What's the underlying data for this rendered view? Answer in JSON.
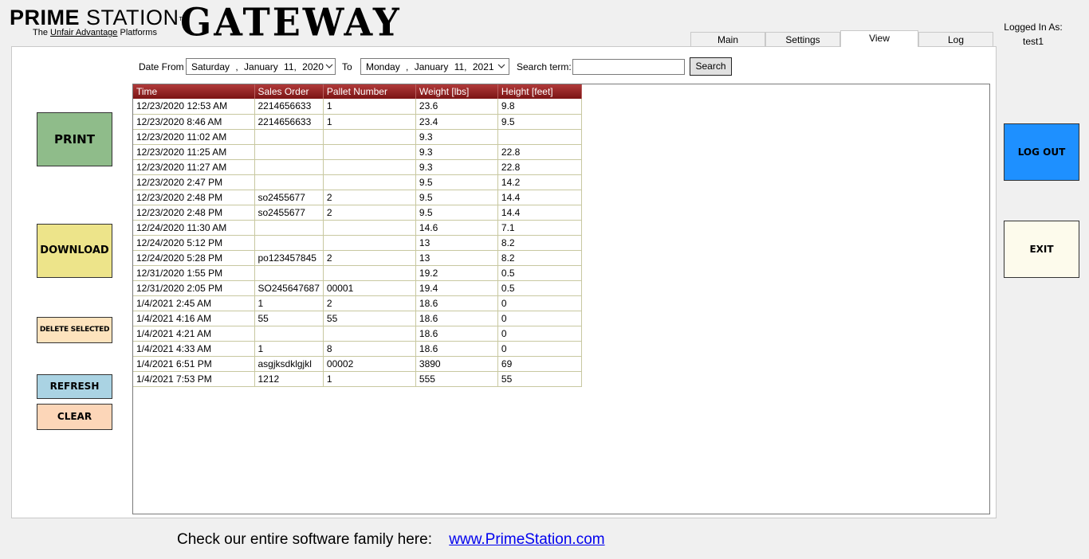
{
  "logo": {
    "prime": "PRIME",
    "station": "STATION",
    "tm": "TM",
    "sub_pre": "The",
    "sub_underline": "Unfair Advantage",
    "sub_post": "Platforms",
    "product": "GATEWAY"
  },
  "user": {
    "label": "Logged In As:",
    "name": "test1"
  },
  "tabs": [
    {
      "label": "Main",
      "active": false
    },
    {
      "label": "Settings",
      "active": false
    },
    {
      "label": "View",
      "active": true
    },
    {
      "label": "Log",
      "active": false
    }
  ],
  "filter": {
    "date_from_label": "Date From",
    "date_from_value": "Saturday , January 11, 2020",
    "to_label": "To",
    "date_to_value": "Monday , January 11, 2021",
    "search_label": "Search term:",
    "search_value": "",
    "search_button": "Search"
  },
  "table": {
    "columns": [
      "Time",
      "Sales Order",
      "Pallet Number",
      "Weight [lbs]",
      "Height [feet]"
    ],
    "rows": [
      [
        "12/23/2020 12:53 AM",
        "2214656633",
        "1",
        "23.6",
        "9.8"
      ],
      [
        "12/23/2020 8:46 AM",
        "2214656633",
        "1",
        "23.4",
        "9.5"
      ],
      [
        "12/23/2020 11:02 AM",
        "",
        "",
        "9.3",
        ""
      ],
      [
        "12/23/2020 11:25 AM",
        "",
        "",
        "9.3",
        "22.8"
      ],
      [
        "12/23/2020 11:27 AM",
        "",
        "",
        "9.3",
        "22.8"
      ],
      [
        "12/23/2020 2:47 PM",
        "",
        "",
        "9.5",
        "14.2"
      ],
      [
        "12/23/2020 2:48 PM",
        "so2455677",
        "2",
        "9.5",
        "14.4"
      ],
      [
        "12/23/2020 2:48 PM",
        "so2455677",
        "2",
        "9.5",
        "14.4"
      ],
      [
        "12/24/2020 11:30 AM",
        "",
        "",
        "14.6",
        "7.1"
      ],
      [
        "12/24/2020 5:12 PM",
        "",
        "",
        "13",
        "8.2"
      ],
      [
        "12/24/2020 5:28 PM",
        "po123457845",
        "2",
        "13",
        "8.2"
      ],
      [
        "12/31/2020 1:55 PM",
        "",
        "",
        "19.2",
        "0.5"
      ],
      [
        "12/31/2020 2:05 PM",
        "SO245647687",
        "00001",
        "19.4",
        "0.5"
      ],
      [
        "1/4/2021 2:45 AM",
        "1",
        "2",
        "18.6",
        "0"
      ],
      [
        "1/4/2021 4:16 AM",
        "55",
        "55",
        "18.6",
        "0"
      ],
      [
        "1/4/2021 4:21 AM",
        "",
        "",
        "18.6",
        "0"
      ],
      [
        "1/4/2021 4:33 AM",
        "1",
        "8",
        "18.6",
        "0"
      ],
      [
        "1/4/2021 6:51 PM",
        "asgjksdklgjkl",
        "00002",
        "3890",
        "69"
      ],
      [
        "1/4/2021 7:53 PM",
        "1212",
        "1",
        "555",
        "55"
      ]
    ]
  },
  "buttons": {
    "print": "PRINT",
    "download": "DOWNLOAD",
    "delete_selected": "DELETE SELECTED",
    "refresh": "REFRESH",
    "clear": "CLEAR",
    "logout": "LOG OUT",
    "exit": "EXIT"
  },
  "footer": {
    "text": "Check our entire software family here:",
    "link": "www.PrimeStation.com"
  },
  "colors": {
    "print": "#8fbc8a",
    "download": "#ede48a",
    "delete": "#fde3bd",
    "refresh": "#aad3e3",
    "clear": "#fcd6b8",
    "logout": "#1e90ff",
    "exit": "#fdfbec",
    "header": "#7a1414"
  },
  "icons": {
    "dropdown": "chevron-down-icon"
  }
}
